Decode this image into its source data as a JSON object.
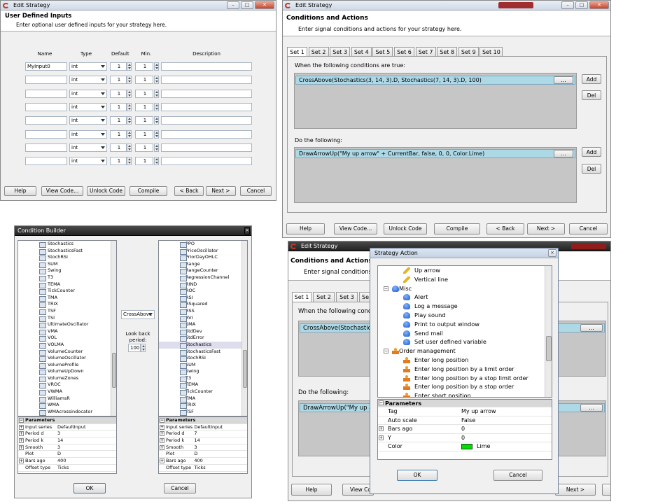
{
  "w1": {
    "title": "Edit Strategy",
    "header": "User Defined Inputs",
    "subheader": "Enter optional user defined inputs for your strategy here.",
    "cols": [
      "Name",
      "Type",
      "Default",
      "Min.",
      "Description"
    ],
    "rows": [
      {
        "name": "MyInput0",
        "type": "int",
        "def": "1",
        "min": "1"
      },
      {
        "name": "",
        "type": "int",
        "def": "1",
        "min": "1"
      },
      {
        "name": "",
        "type": "int",
        "def": "1",
        "min": "1"
      },
      {
        "name": "",
        "type": "int",
        "def": "1",
        "min": "1"
      },
      {
        "name": "",
        "type": "int",
        "def": "1",
        "min": "1"
      },
      {
        "name": "",
        "type": "int",
        "def": "1",
        "min": "1"
      },
      {
        "name": "",
        "type": "int",
        "def": "1",
        "min": "1"
      },
      {
        "name": "",
        "type": "int",
        "def": "1",
        "min": "1"
      }
    ],
    "buttons": [
      "Help",
      "View Code...",
      "Unlock Code",
      "Compile",
      "< Back",
      "Next >",
      "Cancel"
    ]
  },
  "w2": {
    "title": "Edit Strategy",
    "header": "Conditions and Actions",
    "subheader": "Enter signal conditions and actions for your strategy here.",
    "tabs": [
      "Set 1",
      "Set 2",
      "Set 3",
      "Set 4",
      "Set 5",
      "Set 6",
      "Set 7",
      "Set 8",
      "Set 9",
      "Set 10"
    ],
    "cond_label": "When the following conditions are true:",
    "condition": "CrossAbove(Stochastics(3, 14, 3).D, Stochastics(7, 14, 3).D, 100)",
    "action_label": "Do the following:",
    "action": "DrawArrowUp(\"My up arrow\" + CurrentBar, false, 0, 0, Color.Lime)",
    "ellipsis": "...",
    "add": "Add",
    "del": "Del",
    "buttons": [
      "Help",
      "View Code...",
      "Unlock Code",
      "Compile",
      "< Back",
      "Next >",
      "Cancel"
    ]
  },
  "w3": {
    "title": "Condition Builder",
    "left_list": [
      "Stochastics",
      "StochasticsFast",
      "StochRSI",
      "SUM",
      "Swing",
      "T3",
      "TEMA",
      "TickCounter",
      "TMA",
      "TRIX",
      "TSF",
      "TSI",
      "UltimateOscillator",
      "VMA",
      "VOL",
      "VOLMA",
      "VolumeCounter",
      "VolumeOscillator",
      "VolumeProfile",
      "VolumeUpDown",
      "VolumeZones",
      "VROC",
      "VWMA",
      "WilliamsR",
      "WMA",
      "WMAcrossindocator"
    ],
    "right_list": [
      "PPO",
      "PriceOscillator",
      "PriorDayOHLC",
      "Range",
      "RangeCounter",
      "RegressionChannel",
      "RIND",
      "ROC",
      "RSI",
      "RSquared",
      "RSS",
      "RVI",
      "SMA",
      "StdDev",
      "StdError",
      "Stochastics",
      "StochasticsFast",
      "StochRSI",
      "SUM",
      "Swing",
      "T3",
      "TEMA",
      "TickCounter",
      "TMA",
      "TRIX",
      "TSF"
    ],
    "operator": "CrossAbove",
    "lookback_label": "Look back period:",
    "lookback": "100",
    "params_title": "Parameters",
    "left_params": [
      {
        "k": "Input series",
        "v": "DefaultInput",
        "plus": true
      },
      {
        "k": "Period d",
        "v": "3",
        "plus": true
      },
      {
        "k": "Period k",
        "v": "14",
        "plus": true
      },
      {
        "k": "Smooth",
        "v": "3",
        "plus": true
      },
      {
        "k": "Plot",
        "v": "D",
        "plus": false
      },
      {
        "k": "Bars ago",
        "v": "400",
        "plus": true
      },
      {
        "k": "Offset type",
        "v": "Ticks",
        "plus": false
      }
    ],
    "right_params": [
      {
        "k": "Input series",
        "v": "DefaultInput",
        "plus": true
      },
      {
        "k": "Period d",
        "v": "7",
        "plus": true
      },
      {
        "k": "Period k",
        "v": "14",
        "plus": true
      },
      {
        "k": "Smooth",
        "v": "3",
        "plus": true
      },
      {
        "k": "Plot",
        "v": "D",
        "plus": false
      },
      {
        "k": "Bars ago",
        "v": "400",
        "plus": true
      },
      {
        "k": "Offset type",
        "v": "Ticks",
        "plus": false
      }
    ],
    "ok": "OK",
    "cancel": "Cancel"
  },
  "w4": {
    "title": "Edit Strategy",
    "header": "Conditions and Actions",
    "subheader": "Enter signal conditions ar",
    "tabs": [
      "Set 1",
      "Set 2",
      "Set 3",
      "Se"
    ],
    "cond_label": "When the following conditio",
    "condition": "CrossAbove(Stochastics(3",
    "action_label": "Do the following:",
    "action": "DrawArrowUp(\"My up arr",
    "ellipsis": "...",
    "buttons": [
      "Help",
      "View Co",
      "Next >"
    ]
  },
  "w5": {
    "title": "Strategy Action",
    "tree": [
      {
        "label": "Up arrow",
        "icon": "pencil",
        "indent": true
      },
      {
        "label": "Vertical line",
        "icon": "pencil",
        "indent": true
      },
      {
        "label": "Misc",
        "icon": "blue",
        "indent": false,
        "exp": "−"
      },
      {
        "label": "Alert",
        "icon": "blue",
        "indent": true
      },
      {
        "label": "Log a message",
        "icon": "blue",
        "indent": true
      },
      {
        "label": "Play sound",
        "icon": "blue",
        "indent": true
      },
      {
        "label": "Print to output window",
        "icon": "blue",
        "indent": true
      },
      {
        "label": "Send mail",
        "icon": "blue",
        "indent": true
      },
      {
        "label": "Set user defined variable",
        "icon": "blue",
        "indent": true
      },
      {
        "label": "Order management",
        "icon": "person",
        "indent": false,
        "exp": "−"
      },
      {
        "label": "Enter long position",
        "icon": "person",
        "indent": true
      },
      {
        "label": "Enter long position by a limit order",
        "icon": "person",
        "indent": true
      },
      {
        "label": "Enter long position by a stop limit order",
        "icon": "person",
        "indent": true
      },
      {
        "label": "Enter long position by a stop order",
        "icon": "person",
        "indent": true
      },
      {
        "label": "Enter short position",
        "icon": "person",
        "indent": true
      }
    ],
    "params_title": "Parameters",
    "params": [
      {
        "k": "Tag",
        "v": "My up arrow",
        "plus": false
      },
      {
        "k": "Auto scale",
        "v": "False",
        "plus": false
      },
      {
        "k": "Bars ago",
        "v": "0",
        "plus": true
      },
      {
        "k": "Y",
        "v": "0",
        "plus": true
      },
      {
        "k": "Color",
        "v": "Lime",
        "plus": false,
        "swatch": "#00e000"
      }
    ],
    "ok": "OK",
    "cancel": "Cancel"
  },
  "colors": {
    "highlight": "#add8e6",
    "gray": "#c6c6c6",
    "lime": "#00e000"
  }
}
